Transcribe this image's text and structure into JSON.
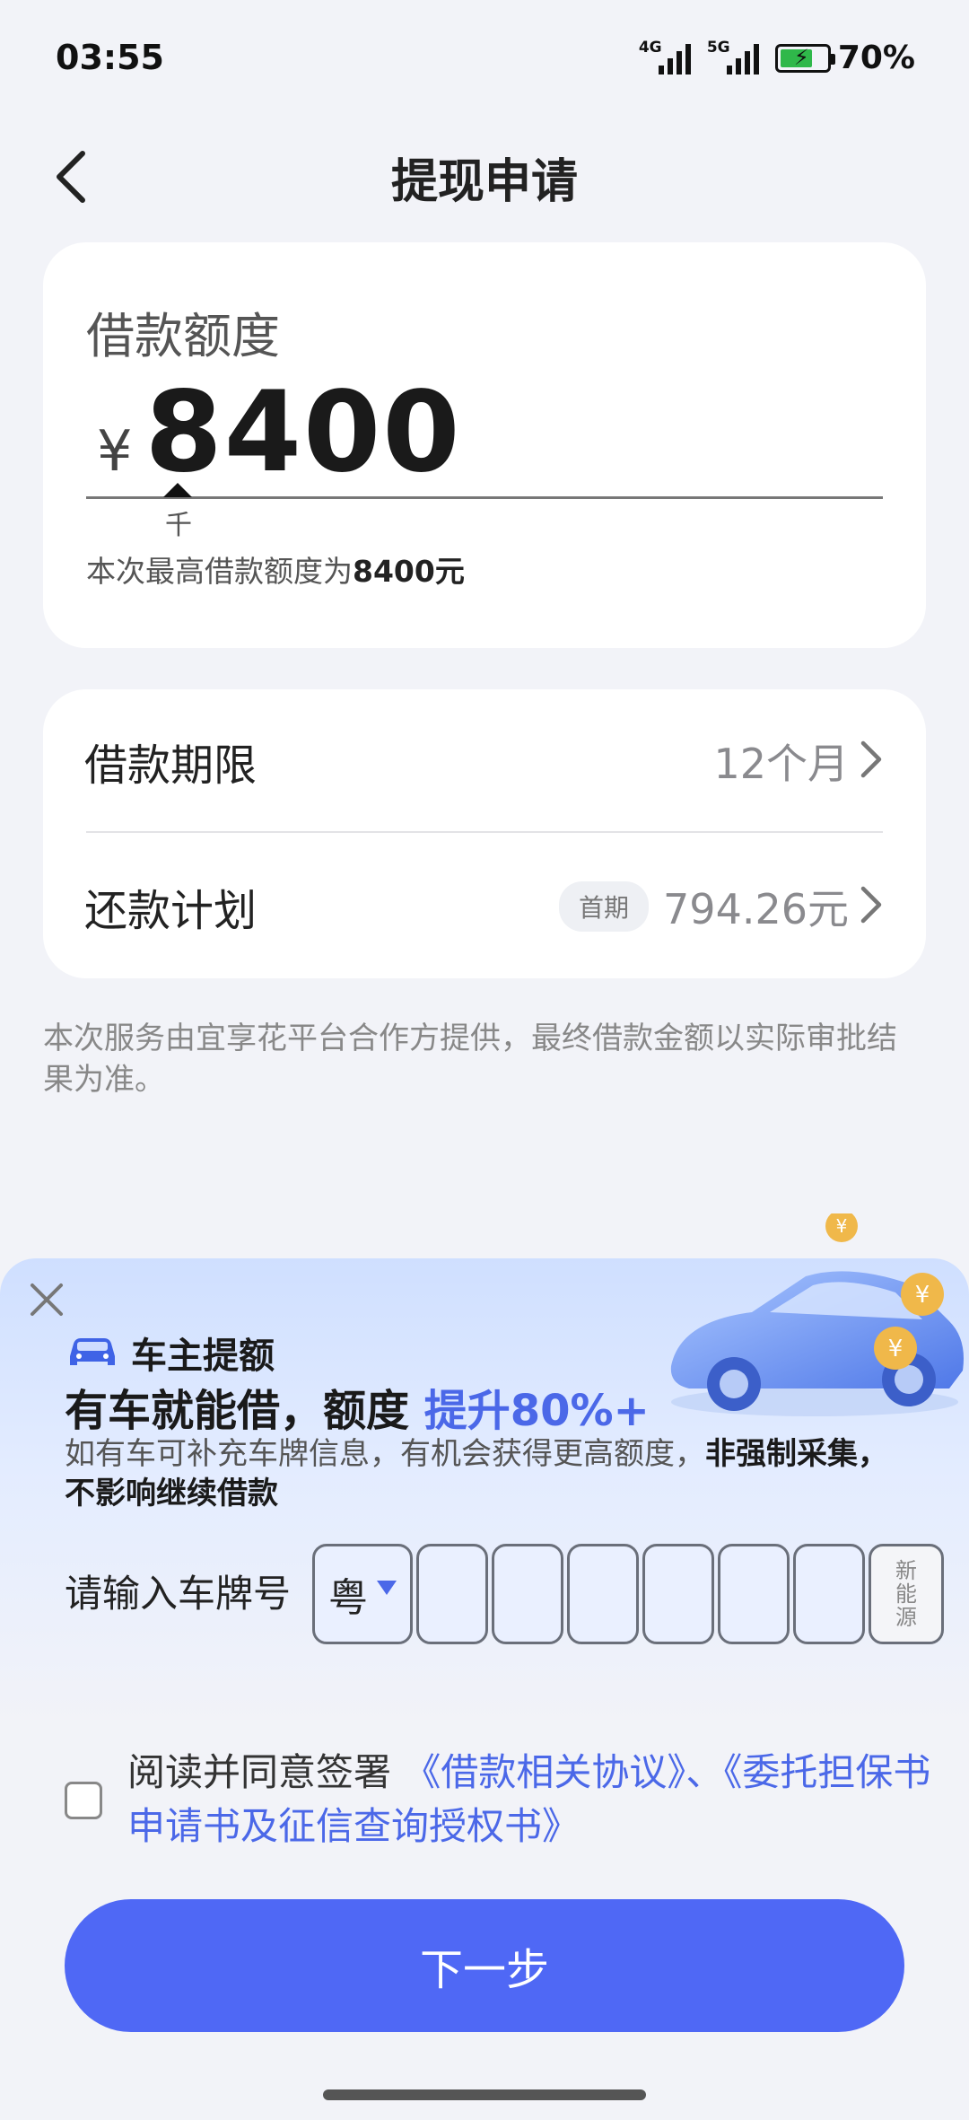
{
  "status_bar": {
    "time": "03:55",
    "signal_1_label": "4G",
    "signal_2_label": "5G",
    "battery_percent": "70%",
    "battery_level": 0.7,
    "battery_charging": true
  },
  "header": {
    "title": "提现申请",
    "back_icon": "chevron-left-icon"
  },
  "amount_card": {
    "label": "借款额度",
    "currency": "¥",
    "amount": "8400",
    "unit_hint": "千",
    "max_hint_prefix": "本次最高借款额度为",
    "max_hint_value": "8400元"
  },
  "term_card": {
    "term_label": "借款期限",
    "term_value": "12个月",
    "plan_label": "还款计划",
    "plan_badge": "首期",
    "plan_value": "794.26元"
  },
  "disclaimer": "本次服务由宜享花平台合作方提供，最终借款金额以实际审批结果为准。",
  "promo": {
    "badge": "车主提额",
    "title_prefix": "有车就能借，额度",
    "title_highlight": "提升80%+",
    "desc_prefix": "如有车可补充车牌信息，有机会获得更高额度，",
    "desc_bold": "非强制采集，不影响继续借款",
    "plate_label": "请输入车牌号",
    "plate_province": "粤",
    "plate_new_energy": "新能源",
    "colors": {
      "highlight": "#4b68e8",
      "panel": "#cfdfff"
    }
  },
  "agreement": {
    "prefix": "阅读并同意签署",
    "link_1": "《借款相关协议》",
    "separator": "、",
    "link_2": "《委托担保书申请书及征信查询授权书》",
    "checked": false
  },
  "next_button": "下一步",
  "colors": {
    "primary": "#4f68f5",
    "background": "#f2f3f8"
  }
}
